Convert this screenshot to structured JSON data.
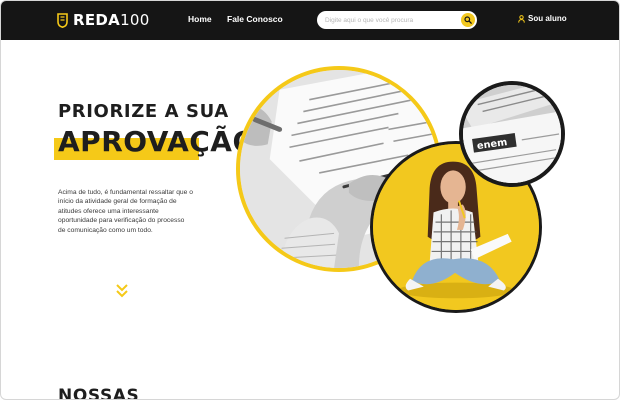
{
  "brand": {
    "name_bold": "REDA",
    "name_light": "100"
  },
  "nav": {
    "home": "Home",
    "contact": "Fale Conosco"
  },
  "search": {
    "placeholder": "Digite aqui o que você procura"
  },
  "account": {
    "label": "Sou aluno"
  },
  "hero": {
    "title_line1": "PRIORIZE A SUA",
    "title_line2": "APROVAÇÃO",
    "text": "Acima de tudo, é fundamental ressaltar que o início da atividade geral de formação de atitudes oferece uma interessante oportunidade para verificação do processo de comunicação como um todo."
  },
  "images": {
    "exam_paper_text": "enem"
  },
  "section": {
    "title": "NOSSAS"
  },
  "colors": {
    "accent": "#f5c918",
    "header_bg": "#151515",
    "text": "#1e1e1e"
  },
  "icons": {
    "logo": "shield-logo-icon",
    "search": "search-icon",
    "user": "user-icon",
    "scroll": "chevron-double-down-icon"
  }
}
